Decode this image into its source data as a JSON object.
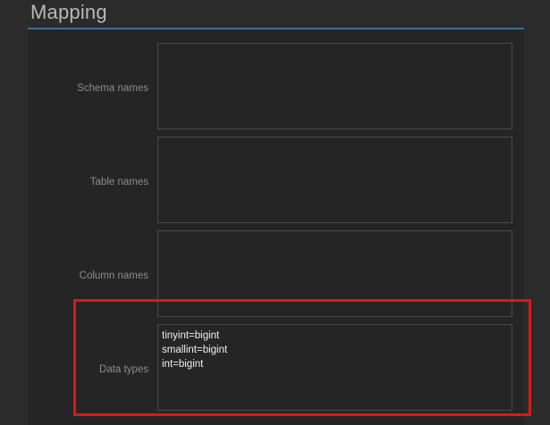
{
  "section": {
    "title": "Mapping"
  },
  "rows": [
    {
      "label": "Schema names",
      "value": ""
    },
    {
      "label": "Table names",
      "value": ""
    },
    {
      "label": "Column names",
      "value": ""
    },
    {
      "label": "Data types",
      "value": "tinyint=bigint\nsmallint=bigint\nint=bigint"
    }
  ],
  "colors": {
    "accent_rule": "#3b6f9c",
    "highlight": "#e01616"
  }
}
